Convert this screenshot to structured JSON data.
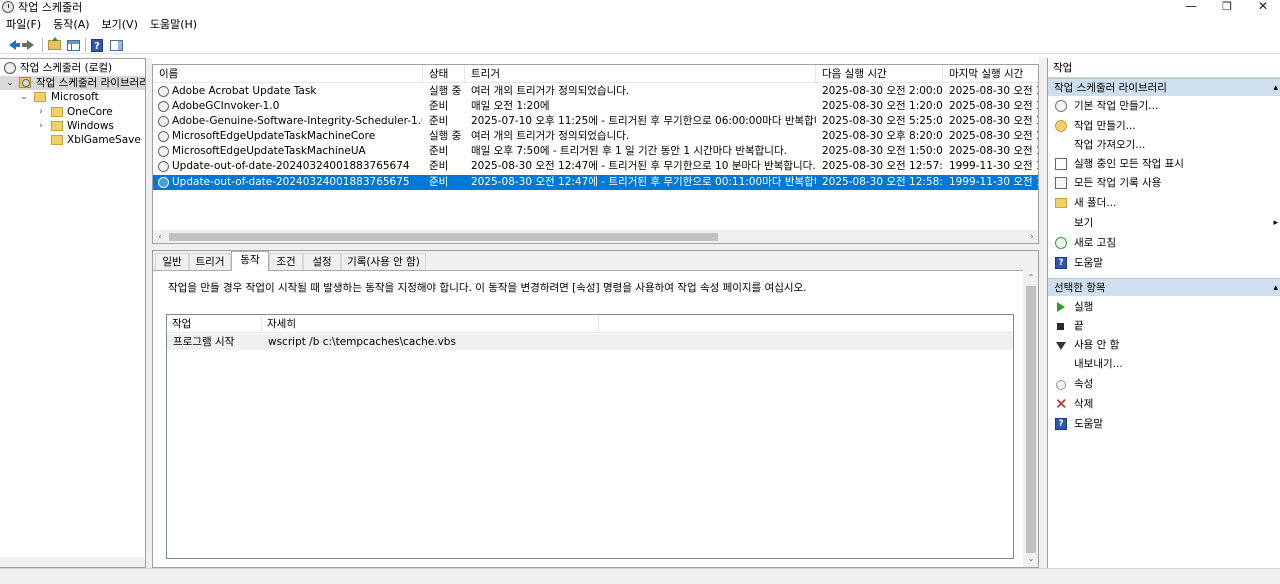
{
  "window": {
    "title": "작업 스케줄러",
    "controls": {
      "minimize": "—",
      "maximize": "❐",
      "close": "✕"
    }
  },
  "menubar": [
    {
      "label": "파일(F)"
    },
    {
      "label": "동작(A)"
    },
    {
      "label": "보기(V)"
    },
    {
      "label": "도움말(H)"
    }
  ],
  "toolbar": [
    {
      "icon": "back-arrow-icon"
    },
    {
      "icon": "forward-arrow-icon"
    },
    {
      "icon": "folder-up-icon"
    },
    {
      "icon": "show-hide-console-tree-icon"
    },
    {
      "icon": "help-icon",
      "label": "?"
    },
    {
      "icon": "show-hide-action-pane-icon"
    }
  ],
  "tree": {
    "items": [
      {
        "label": "작업 스케줄러 (로컬)",
        "icon": "clock-icon",
        "expander": ""
      },
      {
        "label": "작업 스케줄러 라이브러리",
        "icon": "library-folder-icon",
        "expander": "⌄"
      },
      {
        "label": "Microsoft",
        "icon": "folder-icon",
        "expander": "⌄"
      },
      {
        "label": "OneCore",
        "icon": "folder-icon",
        "expander": "›"
      },
      {
        "label": "Windows",
        "icon": "folder-icon",
        "expander": "›"
      },
      {
        "label": "XblGameSave",
        "icon": "folder-icon",
        "expander": ""
      }
    ]
  },
  "tasklist": {
    "columns": [
      "이름",
      "상태",
      "트리거",
      "다음 실행 시간",
      "마지막 실행 시간"
    ],
    "rows": [
      {
        "name": "Adobe Acrobat Update Task",
        "status": "실행 중",
        "trigger": "여러 개의 트리거가 정의되었습니다.",
        "next": "2025-08-30 오전 2:00:00",
        "last": "2025-08-30 오전 12"
      },
      {
        "name": "AdobeGCInvoker-1.0",
        "status": "준비",
        "trigger": "매일 오전 1:20에",
        "next": "2025-08-30 오전 1:20:00",
        "last": "2025-08-30 오전 12"
      },
      {
        "name": "Adobe-Genuine-Software-Integrity-Scheduler-1.0",
        "status": "준비",
        "trigger": "2025-07-10 오후 11:25에 - 트리거된 후 무기한으로 06:00:00마다 반복합니다.",
        "next": "2025-08-30 오전 5:25:00",
        "last": "2025-08-30 오전 12"
      },
      {
        "name": "MicrosoftEdgeUpdateTaskMachineCore",
        "status": "실행 중",
        "trigger": "여러 개의 트리거가 정의되었습니다.",
        "next": "2025-08-30 오후 8:20:05",
        "last": "2025-08-30 오전 12"
      },
      {
        "name": "MicrosoftEdgeUpdateTaskMachineUA",
        "status": "준비",
        "trigger": "매일 오후 7:50에 - 트리거된 후 1 일 기간 동안 1 시간마다 반복합니다.",
        "next": "2025-08-30 오전 1:50:05",
        "last": "2025-08-30 오전 12"
      },
      {
        "name": "Update-out-of-date-20240324001883765674",
        "status": "준비",
        "trigger": "2025-08-30 오전 12:47에 - 트리거된 후 무기한으로 10 분마다 반복합니다.",
        "next": "2025-08-30 오전 12:57:00",
        "last": "1999-11-30 오전 12"
      },
      {
        "name": "Update-out-of-date-20240324001883765675",
        "status": "준비",
        "trigger": "2025-08-30 오전 12:47에 - 트리거된 후 무기한으로 00:11:00마다 반복합니다.",
        "next": "2025-08-30 오전 12:58:00",
        "last": "1999-11-30 오전 12",
        "selected": true
      }
    ],
    "scroll_left": "‹",
    "scroll_right": "›"
  },
  "detail": {
    "tabs": [
      "일반",
      "트리거",
      "동작",
      "조건",
      "설정",
      "기록(사용 안 함)"
    ],
    "active_tab": "동작",
    "description": "작업을 만들 경우 작업이 시작될 때 발생하는 동작을 지정해야 합니다. 이 동작을 변경하려면 [속성] 명령을 사용하여 작업 속성 페이지를 여십시오.",
    "actions_table": {
      "columns": [
        "작업",
        "자세히"
      ],
      "rows": [
        {
          "action": "프로그램 시작",
          "details": "wscript /b c:\\tempcaches\\cache.vbs"
        }
      ]
    },
    "scroll_up": "⌃",
    "scroll_down": "⌄"
  },
  "actions_pane": {
    "title": "작업",
    "section1": {
      "title": "작업 스케줄러 라이브러리",
      "items": [
        {
          "label": "기본 작업 만들기...",
          "icon": "create-basic-task-icon"
        },
        {
          "label": "작업 만들기...",
          "icon": "create-task-icon"
        },
        {
          "label": "작업 가져오기...",
          "icon": "import-task-icon"
        },
        {
          "label": "실행 중인 모든 작업 표시",
          "icon": "display-running-tasks-icon"
        },
        {
          "label": "모든 작업 기록 사용",
          "icon": "enable-history-icon"
        },
        {
          "label": "새 폴더...",
          "icon": "new-folder-icon"
        },
        {
          "label": "보기",
          "icon": "",
          "submenu": "▸"
        },
        {
          "label": "새로 고침",
          "icon": "refresh-icon"
        },
        {
          "label": "도움말",
          "icon": "help-icon"
        }
      ]
    },
    "section2": {
      "title": "선택한 항목",
      "items": [
        {
          "label": "실행",
          "icon": "run-icon"
        },
        {
          "label": "끝",
          "icon": "end-icon"
        },
        {
          "label": "사용 안 함",
          "icon": "disable-icon"
        },
        {
          "label": "내보내기...",
          "icon": ""
        },
        {
          "label": "속성",
          "icon": "properties-icon"
        },
        {
          "label": "삭제",
          "icon": "delete-icon",
          "glyph": "✕"
        },
        {
          "label": "도움말",
          "icon": "help-icon"
        }
      ]
    },
    "collapse_glyph": "▴",
    "help_glyph": "?"
  },
  "colors": {
    "selection": "#0078d7",
    "section_header": "#cfdff0",
    "pane_border": "#a0a0a0"
  }
}
